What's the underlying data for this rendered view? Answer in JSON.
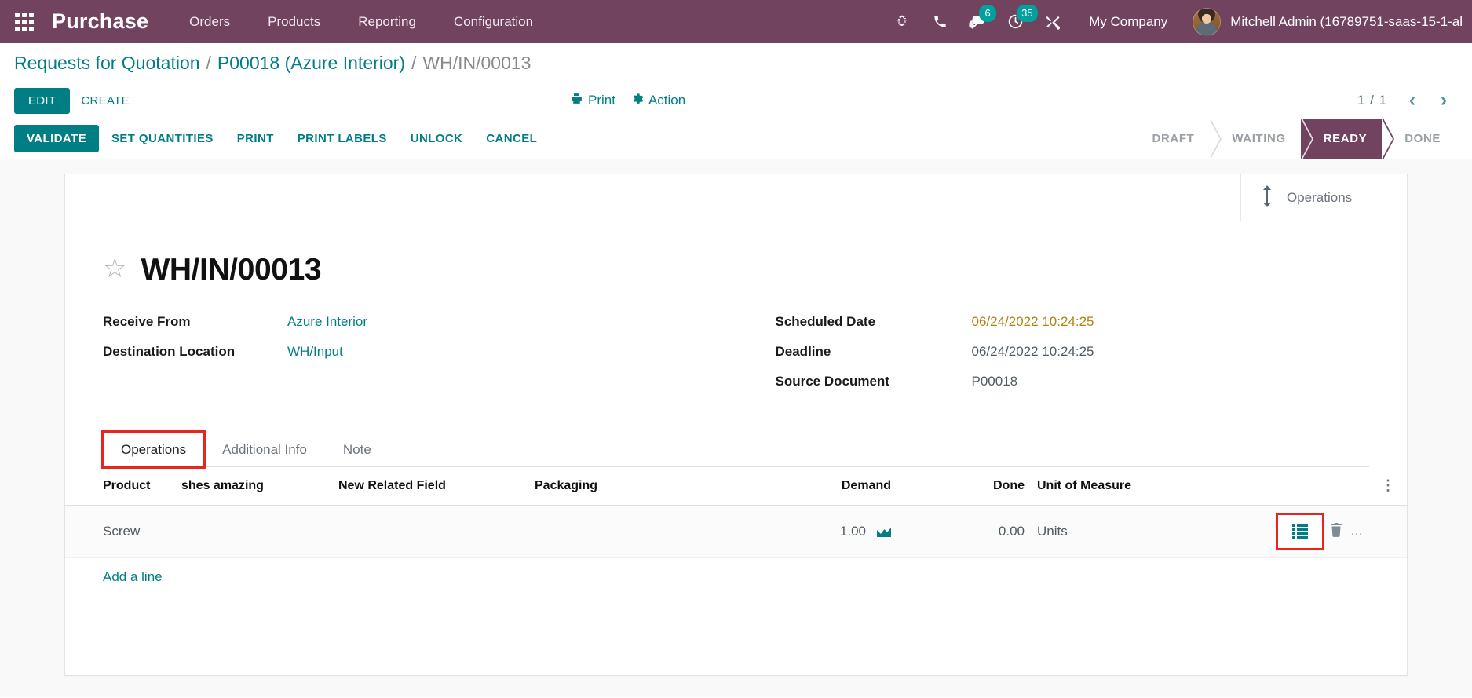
{
  "navbar": {
    "apps_icon": "apps-grid-icon",
    "brand": "Purchase",
    "menu": [
      {
        "label": "Orders"
      },
      {
        "label": "Products"
      },
      {
        "label": "Reporting"
      },
      {
        "label": "Configuration"
      }
    ],
    "icons": [
      {
        "name": "bug-icon",
        "badge": null
      },
      {
        "name": "phone-icon",
        "badge": null
      },
      {
        "name": "messages-icon",
        "badge": "6"
      },
      {
        "name": "activities-clock-icon",
        "badge": "35"
      },
      {
        "name": "tools-icon",
        "badge": null
      }
    ],
    "company": "My Company",
    "user": "Mitchell Admin (16789751-saas-15-1-al",
    "accent_badge_color": "#00a09d",
    "background_color": "#71435f"
  },
  "breadcrumb": {
    "items": [
      {
        "label": "Requests for Quotation",
        "type": "link"
      },
      {
        "label": "P00018 (Azure Interior)",
        "type": "link"
      },
      {
        "label": "WH/IN/00013",
        "type": "current"
      }
    ],
    "separator": "/"
  },
  "control_panel": {
    "edit_label": "EDIT",
    "create_label": "CREATE",
    "print_label": "Print",
    "print_icon": "printer-icon",
    "action_label": "Action",
    "action_icon": "gear-icon",
    "pager_count": "1 / 1",
    "prev_icon": "chevron-left-icon",
    "next_icon": "chevron-right-icon"
  },
  "statusbar": {
    "buttons": [
      {
        "label": "VALIDATE",
        "primary": true
      },
      {
        "label": "SET QUANTITIES",
        "primary": false
      },
      {
        "label": "PRINT",
        "primary": false
      },
      {
        "label": "PRINT LABELS",
        "primary": false
      },
      {
        "label": "UNLOCK",
        "primary": false
      },
      {
        "label": "CANCEL",
        "primary": false
      }
    ],
    "stages": [
      {
        "label": "DRAFT",
        "active": false
      },
      {
        "label": "WAITING",
        "active": false
      },
      {
        "label": "READY",
        "active": true
      },
      {
        "label": "DONE",
        "active": false
      }
    ],
    "active_stage_color": "#71435f"
  },
  "stat_buttons": [
    {
      "icon": "arrows-vertical-icon",
      "label": "Operations"
    }
  ],
  "record": {
    "star_icon": "star-outline-icon",
    "title": "WH/IN/00013",
    "fields_left": [
      {
        "label": "Receive From",
        "value": "Azure Interior",
        "style": "link"
      },
      {
        "label": "Destination Location",
        "value": "WH/Input",
        "style": "link"
      }
    ],
    "fields_right": [
      {
        "label": "Scheduled Date",
        "value": "06/24/2022 10:24:25",
        "style": "warn"
      },
      {
        "label": "Deadline",
        "value": "06/24/2022 10:24:25",
        "style": "plain"
      },
      {
        "label": "Source Document",
        "value": "P00018",
        "style": "plain"
      }
    ]
  },
  "notebook": {
    "tabs": [
      {
        "label": "Operations",
        "active": true,
        "highlighted": true
      },
      {
        "label": "Additional Info",
        "active": false,
        "highlighted": false
      },
      {
        "label": "Note",
        "active": false,
        "highlighted": false
      }
    ],
    "highlight_color": "#e8251f"
  },
  "lines": {
    "columns": [
      {
        "label": "Product",
        "align": "left"
      },
      {
        "label": "shes amazing",
        "align": "left"
      },
      {
        "label": "New Related Field",
        "align": "left"
      },
      {
        "label": "Packaging",
        "align": "left"
      },
      {
        "label": "Demand",
        "align": "right"
      },
      {
        "label": "Done",
        "align": "right"
      },
      {
        "label": "Unit of Measure",
        "align": "left"
      }
    ],
    "optional_columns_icon": "vertical-dots-icon",
    "rows": [
      {
        "product": "Screw",
        "shes_amazing": "",
        "new_related_field": "",
        "packaging": "",
        "demand": "1.00",
        "demand_icon": "forecast-report-icon",
        "done": "0.00",
        "unit_of_measure": "Units",
        "detail_operations_icon": "detailed-operations-icon",
        "delete_icon": "trash-icon"
      }
    ],
    "add_line_label": "Add a line"
  }
}
